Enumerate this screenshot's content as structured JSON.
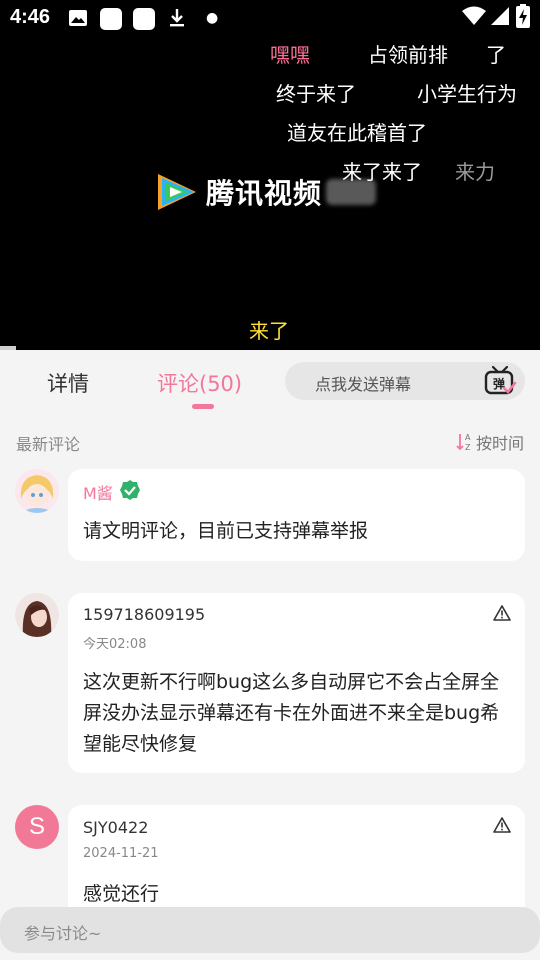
{
  "status_bar": {
    "time": "4:46",
    "icons": [
      "image-icon",
      "app-icon",
      "app-icon",
      "download-icon",
      "dot-icon",
      "wifi-icon",
      "signal-icon",
      "battery-charging-icon"
    ]
  },
  "video": {
    "logo_text": "腾讯视频",
    "danmaku": [
      {
        "text": "嘿嘿",
        "color": "#ff6e96"
      },
      {
        "text": "占领前排",
        "color": "#ffffff"
      },
      {
        "text": "了",
        "color": "#ffffff"
      },
      {
        "text": "终于来了",
        "color": "#ffffff"
      },
      {
        "text": "小学生行为",
        "color": "#ffffff"
      },
      {
        "text": "道友在此稽首了",
        "color": "#ffffff"
      },
      {
        "text": "来了来了",
        "color": "#ffffff"
      },
      {
        "text": "来力",
        "color": "#9a9a9a"
      },
      {
        "text": "来了",
        "color": "#ffe033"
      }
    ]
  },
  "tabs": {
    "details": "详情",
    "comments": "评论(50)"
  },
  "danmu_input": {
    "placeholder": "点我发送弹幕",
    "icon_text": "弹"
  },
  "section": {
    "title": "最新评论",
    "sort_label": "按时间"
  },
  "comments": [
    {
      "user": "M酱",
      "time": "",
      "text": "请文明评论，目前已支持弹幕举报",
      "verified": true
    },
    {
      "user": "159718609195",
      "time": "今天02:08",
      "text": "这次更新不行啊bug这么多自动屏它不会占全屏全屏没办法显示弹幕还有卡在外面进不来全是bug希望能尽快修复"
    },
    {
      "user": "SJY0422",
      "time": "2024-11-21",
      "text": "感觉还行",
      "avatar_letter": "S"
    }
  ],
  "bottom_input": {
    "placeholder": "参与讨论~"
  },
  "colors": {
    "accent": "#f2779b",
    "video_bg": "#000000",
    "page_bg": "#f4f4f4",
    "verified": "#2fb36a"
  }
}
